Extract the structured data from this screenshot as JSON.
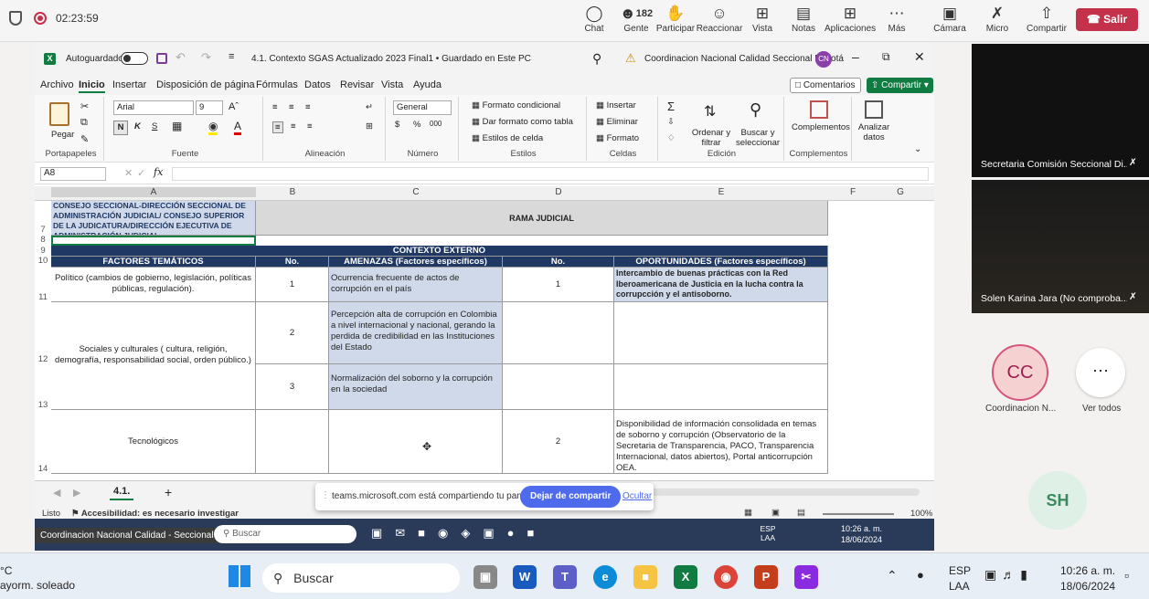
{
  "teams": {
    "timer": "02:23:59",
    "buttons": [
      {
        "label": "Chat",
        "icon": "chat-icon"
      },
      {
        "label": "Gente",
        "icon": "people-icon",
        "count": "182"
      },
      {
        "label": "Participar",
        "icon": "raise-hand-icon"
      },
      {
        "label": "Reaccionar",
        "icon": "smiley-icon"
      },
      {
        "label": "Vista",
        "icon": "grid-icon"
      },
      {
        "label": "Notas",
        "icon": "notes-icon"
      },
      {
        "label": "Aplicaciones",
        "icon": "plus-icon"
      },
      {
        "label": "Más",
        "icon": "more-icon"
      },
      {
        "label": "Cámara",
        "icon": "camera-off-icon"
      },
      {
        "label": "Micro",
        "icon": "mic-off-icon"
      },
      {
        "label": "Compartir",
        "icon": "share-icon"
      }
    ],
    "leave": "Salir"
  },
  "excel": {
    "autosave": "Autoguardado",
    "title": "4.1. Contexto SGAS Actualizado 2023 Final1 • Guardado en Este PC",
    "warning_user": "Coordinacion Nacional Calidad Seccional Bogotá",
    "user_initials": "CN",
    "menu": [
      "Archivo",
      "Inicio",
      "Insertar",
      "Disposición de página",
      "Fórmulas",
      "Datos",
      "Revisar",
      "Vista",
      "Ayuda"
    ],
    "comments": "Comentarios",
    "share": "Compartir",
    "ribbon": {
      "paste": "Pegar",
      "font_name": "Arial",
      "font_size": "9",
      "number_format": "General",
      "cond_format": "Formato condicional",
      "table_format": "Dar formato como tabla",
      "cell_styles": "Estilos de celda",
      "insert": "Insertar",
      "delete": "Eliminar",
      "format": "Formato",
      "sort": "Ordenar y filtrar",
      "find": "Buscar y seleccionar",
      "complements": "Complementos",
      "analyze": "Analizar datos",
      "groups": [
        "Portapapeles",
        "Fuente",
        "Alineación",
        "Número",
        "Estilos",
        "Celdas",
        "Edición",
        "Complementos"
      ]
    },
    "name_box": "A8",
    "columns": [
      "A",
      "B",
      "C",
      "D",
      "E",
      "F",
      "G"
    ],
    "rows": {
      "r7_a": "CONSEJO SECCIONAL-DIRECCIÓN SECCIONAL DE ADMINISTRACIÓN JUDICIAL/ CONSEJO SUPERIOR DE LA JUDICATURA/DIRECCIÓN EJECUTIVA DE ADMINISTRACIÓN JUDICIAL",
      "r7_b": "RAMA JUDICIAL",
      "r9": "CONTEXTO EXTERNO",
      "r10": [
        "FACTORES TEMÁTICOS",
        "No.",
        "AMENAZAS (Factores específicos)",
        "No.",
        "OPORTUNIDADES (Factores específicos)"
      ],
      "r11": [
        "Político (cambios de gobierno, legislación, políticas públicas, regulación).",
        "1",
        "Ocurrencia frecuente de actos de corrupción en el país",
        "1",
        "Intercambio de buenas prácticas con la Red Iberoamericana de Justicia en la lucha contra la corrupcción y el antisoborno."
      ],
      "r12": [
        "Sociales y culturales ( cultura, religión, demografía, responsabilidad social, orden público.)",
        "2",
        "Percepción alta de corrupción en Colombia a nivel internacional y nacional, gerando la perdida de credibilidad en las Instituciones del Estado"
      ],
      "r13": [
        "3",
        "Normalización del soborno y la corrupción en la sociedad"
      ],
      "r14": [
        "Tecnológicos",
        "2",
        "Disponibilidad de información consolidada en temas de soborno y corrupción (Observatorio de la Secretaria de Transparencia, PACO, Transparencia Internacional, datos abiertos), Portal anticorrupción OEA."
      ]
    },
    "row_numbers": [
      "7",
      "8",
      "9",
      "10",
      "11",
      "12",
      "13",
      "14"
    ],
    "sheet_tab": "4.1.",
    "status": "Listo",
    "accessibility": "Accesibilidad: es necesario investigar",
    "zoom": "100%"
  },
  "share_banner": {
    "text": "teams.microsoft.com está compartiendo tu pantalla.",
    "stop": "Dejar de compartir",
    "hide": "Ocultar"
  },
  "inner_taskbar": {
    "label": "Coordinacion Nacional Calidad - Seccional Bogotá",
    "search": "Buscar",
    "lang": "ESP LAA",
    "time": "10:26 a. m.",
    "date": "18/06/2024"
  },
  "participants": [
    {
      "name": "Secretaria Comisión Seccional Di..."
    },
    {
      "name": "Solen Karina Jara (No comproba..."
    },
    {
      "name": "Coordinacion N...",
      "initials": "CC"
    },
    {
      "name": "Ver todos"
    },
    {
      "initials": "SH"
    }
  ],
  "taskbar": {
    "weather_temp": "°C",
    "weather": "ayorm. soleado",
    "search": "Buscar",
    "lang1": "ESP",
    "lang2": "LAA",
    "time": "10:26 a. m.",
    "date": "18/06/2024"
  }
}
